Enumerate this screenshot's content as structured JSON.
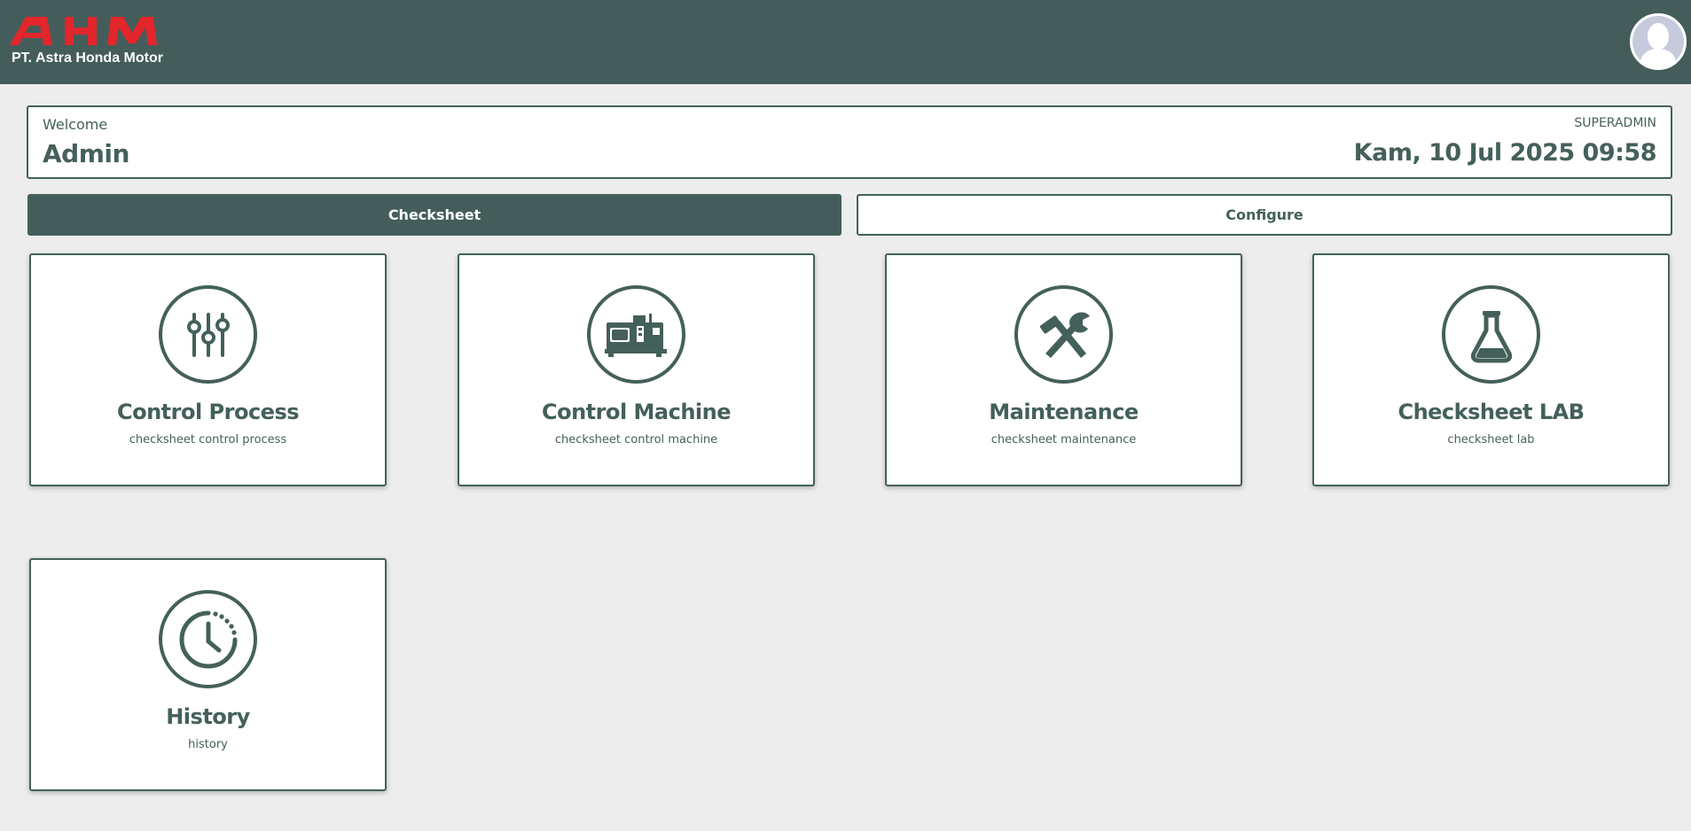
{
  "header": {
    "logo_text": "AHM",
    "company": "PT. Astra Honda Motor",
    "brand_color": "#e2262b",
    "bar_color": "#445d5a",
    "avatar_icon": "user-avatar-icon"
  },
  "welcome": {
    "label": "Welcome",
    "user_name": "Admin",
    "role": "SUPERADMIN",
    "datetime": "Kam, 10 Jul 2025 09:58"
  },
  "tabs": [
    {
      "label": "Checksheet",
      "active": true
    },
    {
      "label": "Configure",
      "active": false
    }
  ],
  "cards": [
    {
      "title": "Control Process",
      "subtitle": "checksheet control process",
      "icon": "sliders-icon"
    },
    {
      "title": "Control Machine",
      "subtitle": "checksheet control machine",
      "icon": "cnc-machine-icon"
    },
    {
      "title": "Maintenance",
      "subtitle": "checksheet maintenance",
      "icon": "hammer-wrench-icon"
    },
    {
      "title": "Checksheet LAB",
      "subtitle": "checksheet lab",
      "icon": "flask-icon"
    },
    {
      "title": "History",
      "subtitle": "history",
      "icon": "history-clock-icon"
    }
  ],
  "colors": {
    "primary": "#44605b",
    "background": "#ededed",
    "card": "#ffffff"
  }
}
